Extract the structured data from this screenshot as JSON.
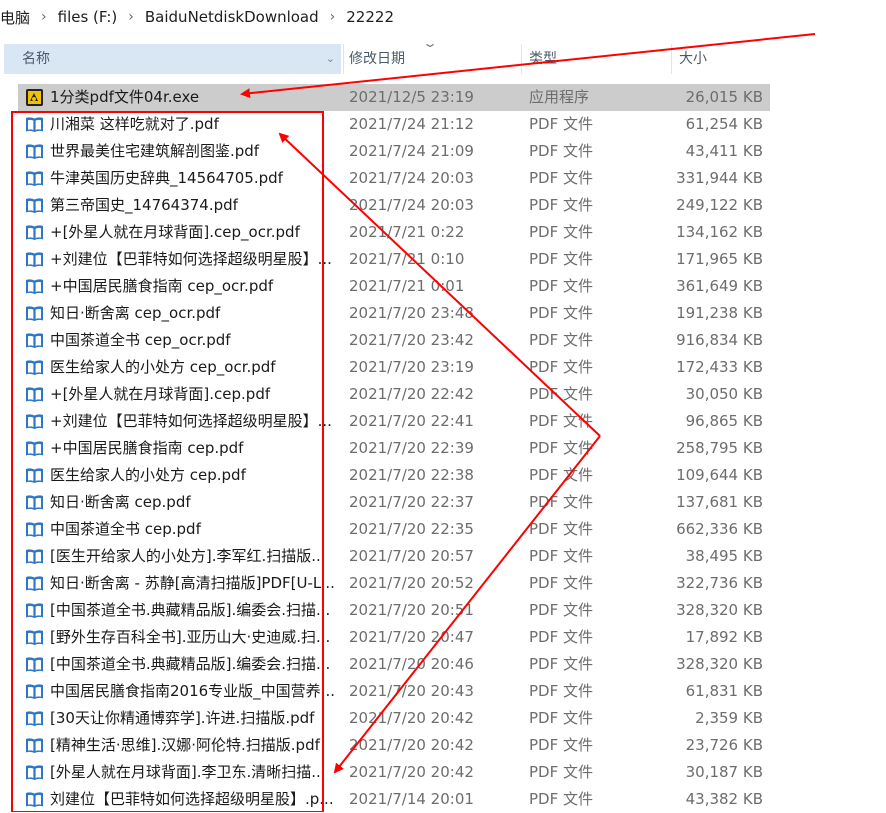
{
  "breadcrumb": [
    "电脑",
    "files (F:)",
    "BaiduNetdiskDownload",
    "22222"
  ],
  "columns": {
    "name": "名称",
    "date": "修改日期",
    "type": "类型",
    "size": "大小"
  },
  "colors": {
    "selection": "#cccccc",
    "header_highlight": "#d9e6f3",
    "annotation_red": "#ff0000",
    "pdf_icon": "#2e77c8"
  },
  "files": [
    {
      "name": "1分类pdf文件04r.exe",
      "date": "2021/12/5 23:19",
      "type": "应用程序",
      "size": "26,015 KB",
      "icon": "exe-icon",
      "selected": true
    },
    {
      "name": "川湘菜 这样吃就对了.pdf",
      "date": "2021/7/24 21:12",
      "type": "PDF 文件",
      "size": "61,254 KB",
      "icon": "pdf-icon"
    },
    {
      "name": "世界最美住宅建筑解剖图鉴.pdf",
      "date": "2021/7/24 21:09",
      "type": "PDF 文件",
      "size": "43,411 KB",
      "icon": "pdf-icon"
    },
    {
      "name": "牛津英国历史辞典_14564705.pdf",
      "date": "2021/7/24 20:03",
      "type": "PDF 文件",
      "size": "331,944 KB",
      "icon": "pdf-icon"
    },
    {
      "name": "第三帝国史_14764374.pdf",
      "date": "2021/7/24 20:03",
      "type": "PDF 文件",
      "size": "249,122 KB",
      "icon": "pdf-icon"
    },
    {
      "name": "+[外星人就在月球背面].cep_ocr.pdf",
      "date": "2021/7/21 0:22",
      "type": "PDF 文件",
      "size": "134,162 KB",
      "icon": "pdf-icon"
    },
    {
      "name": "+刘建位【巴菲特如何选择超级明星股】...",
      "date": "2021/7/21 0:10",
      "type": "PDF 文件",
      "size": "171,965 KB",
      "icon": "pdf-icon"
    },
    {
      "name": "+中国居民膳食指南 cep_ocr.pdf",
      "date": "2021/7/21 0:01",
      "type": "PDF 文件",
      "size": "361,649 KB",
      "icon": "pdf-icon"
    },
    {
      "name": "知日·断舍离 cep_ocr.pdf",
      "date": "2021/7/20 23:48",
      "type": "PDF 文件",
      "size": "191,238 KB",
      "icon": "pdf-icon"
    },
    {
      "name": "中国茶道全书 cep_ocr.pdf",
      "date": "2021/7/20 23:42",
      "type": "PDF 文件",
      "size": "916,834 KB",
      "icon": "pdf-icon"
    },
    {
      "name": "医生给家人的小处方 cep_ocr.pdf",
      "date": "2021/7/20 23:19",
      "type": "PDF 文件",
      "size": "172,433 KB",
      "icon": "pdf-icon"
    },
    {
      "name": "+[外星人就在月球背面].cep.pdf",
      "date": "2021/7/20 22:42",
      "type": "PDF 文件",
      "size": "30,050 KB",
      "icon": "pdf-icon"
    },
    {
      "name": "+刘建位【巴菲特如何选择超级明星股】...",
      "date": "2021/7/20 22:41",
      "type": "PDF 文件",
      "size": "96,865 KB",
      "icon": "pdf-icon"
    },
    {
      "name": "+中国居民膳食指南 cep.pdf",
      "date": "2021/7/20 22:39",
      "type": "PDF 文件",
      "size": "258,795 KB",
      "icon": "pdf-icon"
    },
    {
      "name": "医生给家人的小处方 cep.pdf",
      "date": "2021/7/20 22:38",
      "type": "PDF 文件",
      "size": "109,644 KB",
      "icon": "pdf-icon"
    },
    {
      "name": "知日·断舍离 cep.pdf",
      "date": "2021/7/20 22:37",
      "type": "PDF 文件",
      "size": "137,681 KB",
      "icon": "pdf-icon"
    },
    {
      "name": "中国茶道全书 cep.pdf",
      "date": "2021/7/20 22:35",
      "type": "PDF 文件",
      "size": "662,336 KB",
      "icon": "pdf-icon"
    },
    {
      "name": "[医生开给家人的小处方].李军红.扫描版...",
      "date": "2021/7/20 20:57",
      "type": "PDF 文件",
      "size": "38,495 KB",
      "icon": "pdf-icon"
    },
    {
      "name": "知日·断舍离 - 苏静[高清扫描版]PDF[U-Li...",
      "date": "2021/7/20 20:52",
      "type": "PDF 文件",
      "size": "322,736 KB",
      "icon": "pdf-icon"
    },
    {
      "name": "[中国茶道全书.典藏精品版].编委会.扫描...",
      "date": "2021/7/20 20:51",
      "type": "PDF 文件",
      "size": "328,320 KB",
      "icon": "pdf-icon"
    },
    {
      "name": "[野外生存百科全书].亚历山大·史迪威.扫...",
      "date": "2021/7/20 20:47",
      "type": "PDF 文件",
      "size": "17,892 KB",
      "icon": "pdf-icon"
    },
    {
      "name": "[中国茶道全书.典藏精品版].编委会.扫描...",
      "date": "2021/7/20 20:46",
      "type": "PDF 文件",
      "size": "328,320 KB",
      "icon": "pdf-icon"
    },
    {
      "name": "中国居民膳食指南2016专业版_中国营养...",
      "date": "2021/7/20 20:43",
      "type": "PDF 文件",
      "size": "61,831 KB",
      "icon": "pdf-icon"
    },
    {
      "name": "[30天让你精通博弈学].许进.扫描版.pdf",
      "date": "2021/7/20 20:42",
      "type": "PDF 文件",
      "size": "2,359 KB",
      "icon": "pdf-icon"
    },
    {
      "name": "[精神生活·思维].汉娜·阿伦特.扫描版.pdf",
      "date": "2021/7/20 20:42",
      "type": "PDF 文件",
      "size": "23,726 KB",
      "icon": "pdf-icon"
    },
    {
      "name": "[外星人就在月球背面].李卫东.清晰扫描...",
      "date": "2021/7/20 20:42",
      "type": "PDF 文件",
      "size": "30,187 KB",
      "icon": "pdf-icon"
    },
    {
      "name": "刘建位【巴菲特如何选择超级明星股】.p...",
      "date": "2021/7/14 20:01",
      "type": "PDF 文件",
      "size": "43,382 KB",
      "icon": "pdf-icon"
    }
  ]
}
